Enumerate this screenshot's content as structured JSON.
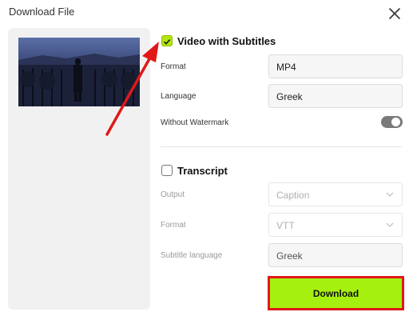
{
  "dialog": {
    "title": "Download File"
  },
  "video_section": {
    "title": "Video with Subtitles",
    "checked": true,
    "fields": {
      "format": {
        "label": "Format",
        "value": "MP4"
      },
      "language": {
        "label": "Language",
        "value": "Greek"
      }
    },
    "watermark": {
      "label": "Without Watermark",
      "enabled": true
    }
  },
  "transcript_section": {
    "title": "Transcript",
    "checked": false,
    "fields": {
      "output": {
        "label": "Output",
        "value": "Caption"
      },
      "format": {
        "label": "Format",
        "value": "VTT"
      },
      "subtitle_language": {
        "label": "Subtitle language",
        "value": "Greek"
      }
    }
  },
  "actions": {
    "download_label": "Download"
  },
  "colors": {
    "accent_green": "#a6f00f",
    "highlight_red": "#e01818",
    "check_green": "#b3e50c"
  },
  "icons": [
    "close-icon",
    "check-icon",
    "chevron-down-icon",
    "annotation-arrow"
  ]
}
